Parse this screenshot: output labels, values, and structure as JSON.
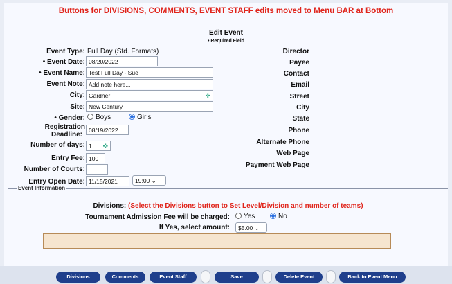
{
  "banner": "Buttons for DIVISIONS, COMMENTS, EVENT STAFF edits moved to Menu BAR at Bottom",
  "header": {
    "title": "Edit Event",
    "required_note": "• Required Field"
  },
  "form": {
    "event_type_label": "Event Type:",
    "event_type_value": "Full Day (Std. Formats)",
    "event_date_label": "• Event Date:",
    "event_date_value": "08/20/2022",
    "event_name_label": "• Event Name:",
    "event_name_value": "Test Full Day - Sue",
    "event_note_label": "Event Note:",
    "event_note_value": "Add note here...",
    "city_label": "City:",
    "city_value": "Gardner",
    "site_label": "Site:",
    "site_value": "New Century",
    "gender_label": "• Gender:",
    "gender_options": [
      "Boys",
      "Girls"
    ],
    "gender_selected": "Girls",
    "registration_label": "Registration",
    "deadline_label": "Deadline:",
    "registration_deadline_value": "08/19/2022",
    "days_label": "Number of days:",
    "days_value": "1",
    "entry_fee_label": "Entry Fee:",
    "entry_fee_value": "100",
    "courts_label": "Number of Courts:",
    "courts_value": "",
    "entry_open_label": "Entry Open Date:",
    "entry_open_date_value": "11/15/2021",
    "entry_open_time_value": "19:00"
  },
  "contact_fields": [
    "Director",
    "Payee",
    "Contact",
    "Email",
    "Street",
    "City",
    "State",
    "Phone",
    "Alternate Phone",
    "Web Page",
    "Payment Web Page"
  ],
  "event_info": {
    "legend": "Event Information",
    "divisions_label": "Divisions:",
    "divisions_message": "(Select the Divisions button to Set Level/Division and number of teams)",
    "admission_label": "Tournament Admission Fee will be charged:",
    "admission_options": [
      "Yes",
      "No"
    ],
    "admission_selected": "No",
    "amount_label": "If Yes, select amount:",
    "amount_value": "$5.00"
  },
  "buttons": [
    "Divisions",
    "Comments",
    "Event Staff",
    "Save",
    "Delete Event",
    "Back to Event Menu"
  ],
  "colors": {
    "banner_red": "#e0241b",
    "button_navy": "#1f3f8c",
    "notes_fill": "#f6e5cf"
  }
}
